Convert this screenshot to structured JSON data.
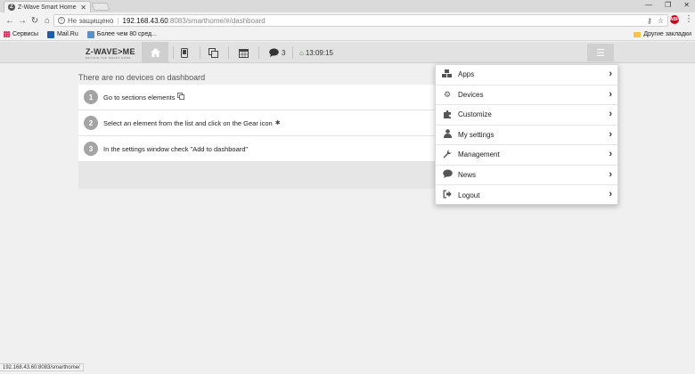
{
  "browser": {
    "tab_title": "Z-Wave Smart Home",
    "favicon_letter": "Z",
    "security_label": "Не защищено",
    "url_host": "192.168.43.60",
    "url_rest": ":8083/smarthome/#/dashboard",
    "bookmarks": [
      {
        "label": "Сервисы",
        "icon": "apps-grid-icon"
      },
      {
        "label": "Mail.Ru",
        "icon": "mailru-icon"
      },
      {
        "label": "Более чем 80 сред...",
        "icon": "bookmark-page-icon"
      }
    ],
    "other_bookmarks": "Другие закладки",
    "abp_label": "ABP",
    "status_url": "192.168.43.60:8083/smarthome/"
  },
  "header": {
    "logo": "Z-WAVE>ME",
    "logo_tagline": "BEYOND THE SMART HOME",
    "events_count": "3",
    "time": "13:09:15",
    "icons": [
      "home-icon",
      "tablet-icon",
      "copy-icon",
      "calendar-icon",
      "comment-icon",
      "leaf-icon",
      "hamburger-icon"
    ]
  },
  "dashboard": {
    "title": "There are no devices on dashboard",
    "steps": [
      {
        "num": "1",
        "text": "Go to sections elements",
        "icon": "copy-icon"
      },
      {
        "num": "2",
        "text": "Select an element from the list and click on the Gear icon",
        "icon": "gear-icon"
      },
      {
        "num": "3",
        "text": "In the settings window check \"Add to dashboard\"",
        "icon": ""
      }
    ]
  },
  "menu": {
    "items": [
      {
        "label": "Apps",
        "icon": "cubes-icon"
      },
      {
        "label": "Devices",
        "icon": "cogs-icon"
      },
      {
        "label": "Customize",
        "icon": "puzzle-icon"
      },
      {
        "label": "My settings",
        "icon": "user-icon"
      },
      {
        "label": "Management",
        "icon": "wrench-icon"
      },
      {
        "label": "News",
        "icon": "comment-icon"
      },
      {
        "label": "Logout",
        "icon": "sign-out-icon"
      }
    ]
  }
}
